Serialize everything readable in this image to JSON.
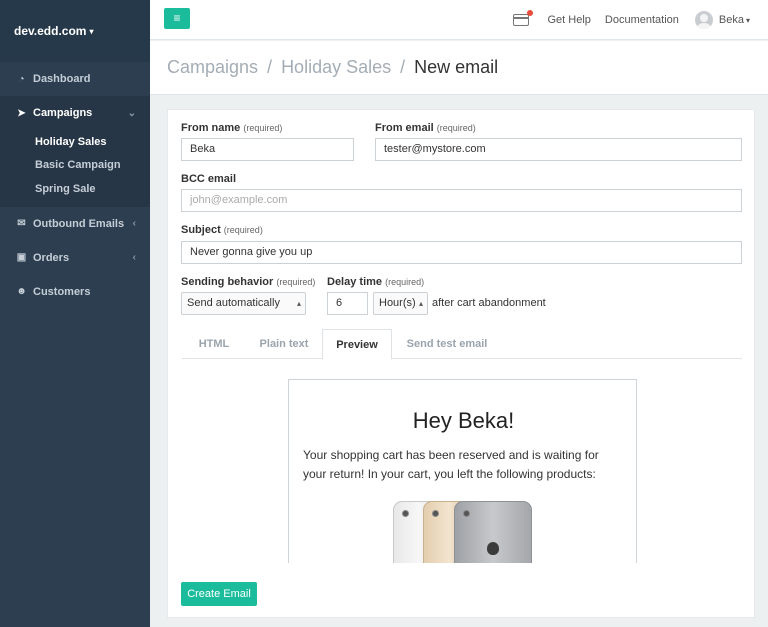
{
  "sidebar": {
    "brand": "dev.edd.com",
    "nav": {
      "dashboard": "Dashboard",
      "campaigns": "Campaigns",
      "outbound": "Outbound Emails",
      "orders": "Orders",
      "customers": "Customers"
    },
    "campaign_items": [
      "Holiday Sales",
      "Basic Campaign",
      "Spring Sale"
    ]
  },
  "topbar": {
    "menu_icon": "≡",
    "get_help": "Get Help",
    "documentation": "Documentation",
    "user": "Beka"
  },
  "breadcrumb": {
    "items": [
      "Campaigns",
      "Holiday Sales",
      "New email"
    ],
    "separator": "/"
  },
  "form": {
    "from_name": {
      "label": "From name",
      "req": "(required)",
      "value": "Beka"
    },
    "from_email": {
      "label": "From email",
      "req": "(required)",
      "value": "tester@mystore.com"
    },
    "bcc": {
      "label": "BCC email",
      "placeholder": "john@example.com"
    },
    "subject": {
      "label": "Subject",
      "req": "(required)",
      "value": "Never gonna give you up"
    },
    "sending": {
      "label": "Sending behavior",
      "req": "(required)",
      "value": "Send automatically"
    },
    "delay": {
      "label": "Delay time",
      "req": "(required)",
      "value": "6",
      "unit": "Hour(s)",
      "after": "after cart abandonment"
    }
  },
  "tabs": [
    "HTML",
    "Plain text",
    "Preview",
    "Send test email"
  ],
  "active_tab": "Preview",
  "preview": {
    "title": "Hey Beka!",
    "body": "Your shopping cart has been reserved and is waiting for your return! In your cart, you left the following products:"
  },
  "create_button": "Create Email",
  "colors": {
    "accent": "#1abc9c",
    "sidebar": "#2c3e50",
    "badge": "#e74c3c"
  }
}
